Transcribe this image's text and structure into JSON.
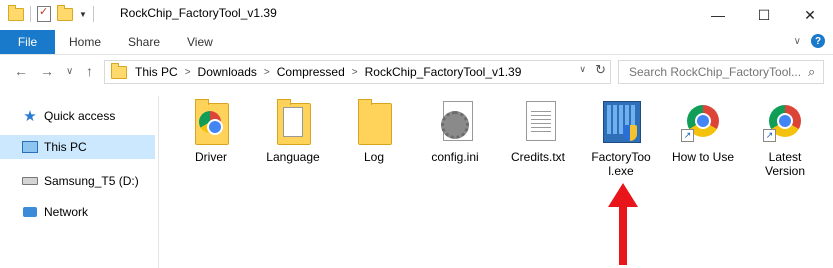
{
  "window": {
    "title": "RockChip_FactoryTool_v1.39",
    "min_glyph": "—",
    "max_glyph": "☐",
    "close_glyph": "✕"
  },
  "ribbon": {
    "file": "File",
    "home": "Home",
    "share": "Share",
    "view": "View",
    "help": "?"
  },
  "address": {
    "crumbs": [
      "This PC",
      "Downloads",
      "Compressed",
      "RockChip_FactoryTool_v1.39"
    ],
    "separator": ">",
    "search_placeholder": "Search RockChip_FactoryTool..."
  },
  "nav": {
    "back": "←",
    "forward": "→",
    "recent": "∨",
    "up": "↑",
    "refresh": "↻",
    "search_icon": "⌕",
    "dropdown": "∨"
  },
  "sidebar": {
    "items": [
      {
        "label": "Quick access",
        "icon": "star-icon"
      },
      {
        "label": "This PC",
        "icon": "computer-icon",
        "selected": true
      },
      {
        "label": "Samsung_T5 (D:)",
        "icon": "drive-icon"
      },
      {
        "label": "Network",
        "icon": "network-icon"
      }
    ]
  },
  "files": [
    {
      "name": "Driver",
      "type": "folder-chrome"
    },
    {
      "name": "Language",
      "type": "folder-docs"
    },
    {
      "name": "Log",
      "type": "folder"
    },
    {
      "name": "config.ini",
      "type": "ini"
    },
    {
      "name": "Credits.txt",
      "type": "text"
    },
    {
      "name": "FactoryToo\nl.exe",
      "type": "exe"
    },
    {
      "name": "How to Use",
      "type": "chrome-shortcut"
    },
    {
      "name": "Latest\nVersion",
      "type": "chrome-shortcut"
    }
  ],
  "colors": {
    "accent": "#1979ca",
    "selected_bg": "#cce8ff",
    "arrow": "#e8151b"
  }
}
